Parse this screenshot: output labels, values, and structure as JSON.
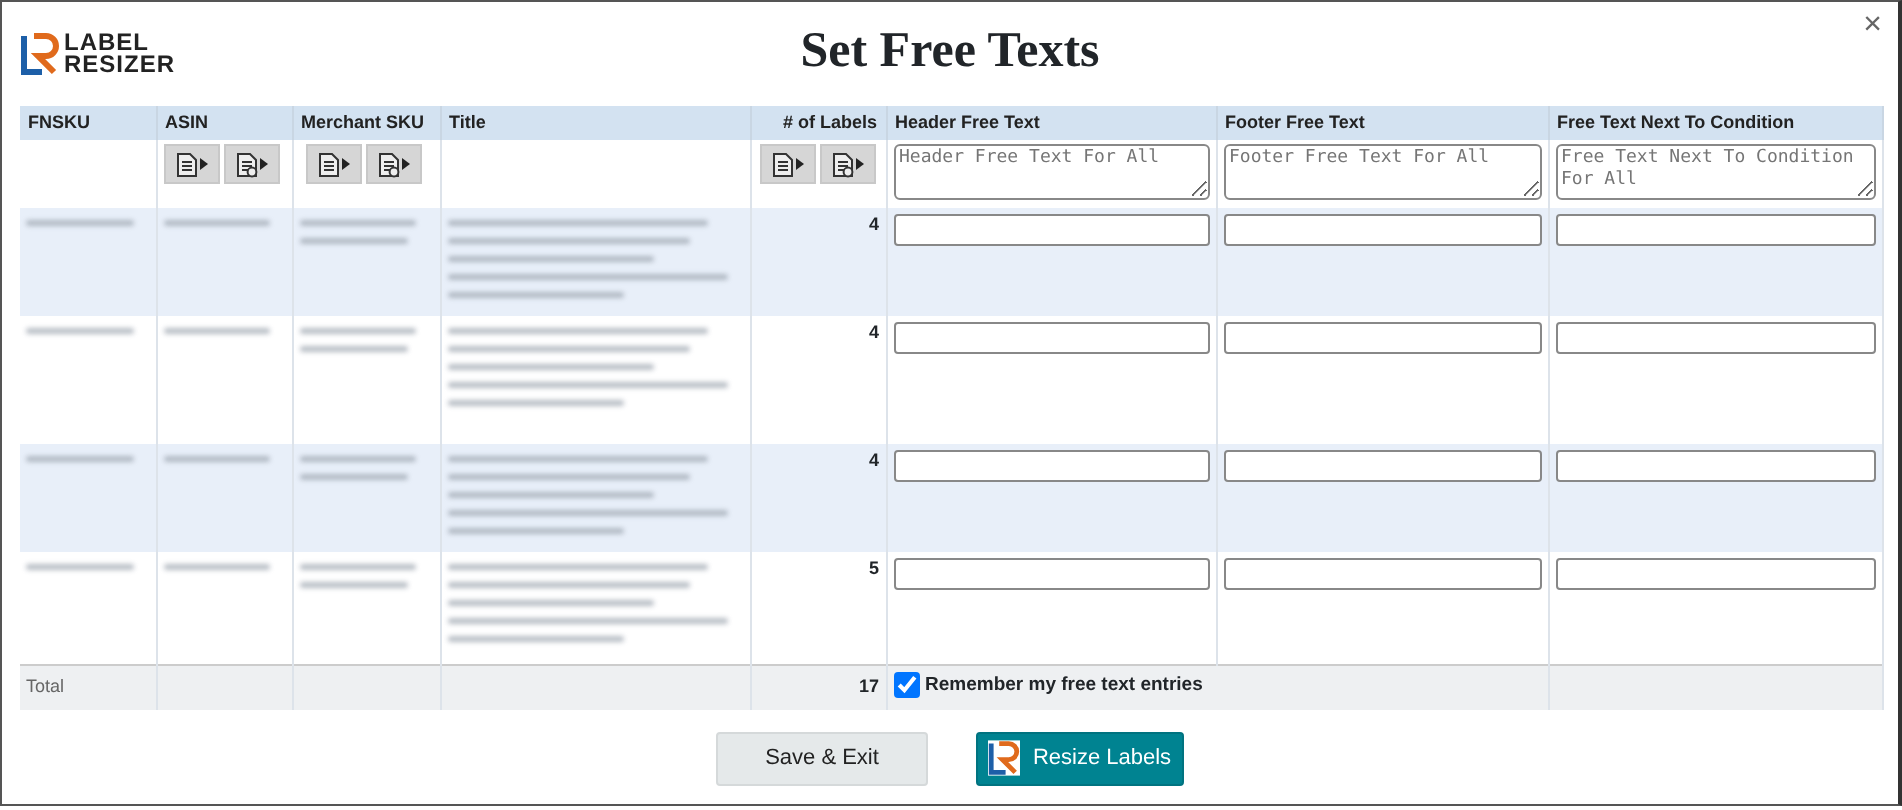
{
  "dialog": {
    "logo": [
      "LABEL",
      "RESIZER"
    ],
    "title": "Set Free Texts",
    "close": "×"
  },
  "table": {
    "columns": [
      {
        "label": "FNSKU",
        "kind": "text"
      },
      {
        "label": "ASIN",
        "kind": "text",
        "tools": true
      },
      {
        "label": "Merchant SKU",
        "kind": "text",
        "tools": true
      },
      {
        "label": "Title",
        "kind": "text"
      },
      {
        "label": "# of Labels",
        "kind": "count",
        "tools": true
      },
      {
        "label": "Header Free Text",
        "kind": "field",
        "placeholder": "Header Free Text For All"
      },
      {
        "label": "Footer Free Text",
        "kind": "field",
        "placeholder": "Footer Free Text For All"
      },
      {
        "label": "Free Text Next To Condition",
        "kind": "field",
        "placeholder": "Free Text Next To Condition For All"
      }
    ],
    "rows": [
      {
        "labels": "4"
      },
      {
        "labels": "4"
      },
      {
        "labels": "4"
      },
      {
        "labels": "5"
      }
    ],
    "total": {
      "label": "Total",
      "labels": "17"
    }
  },
  "remember": {
    "label": "Remember my free text entries",
    "checked": true
  },
  "buttons": [
    {
      "label": "Save & Exit",
      "kind": "plain"
    },
    {
      "label": "Resize Labels",
      "kind": "primary"
    }
  ]
}
